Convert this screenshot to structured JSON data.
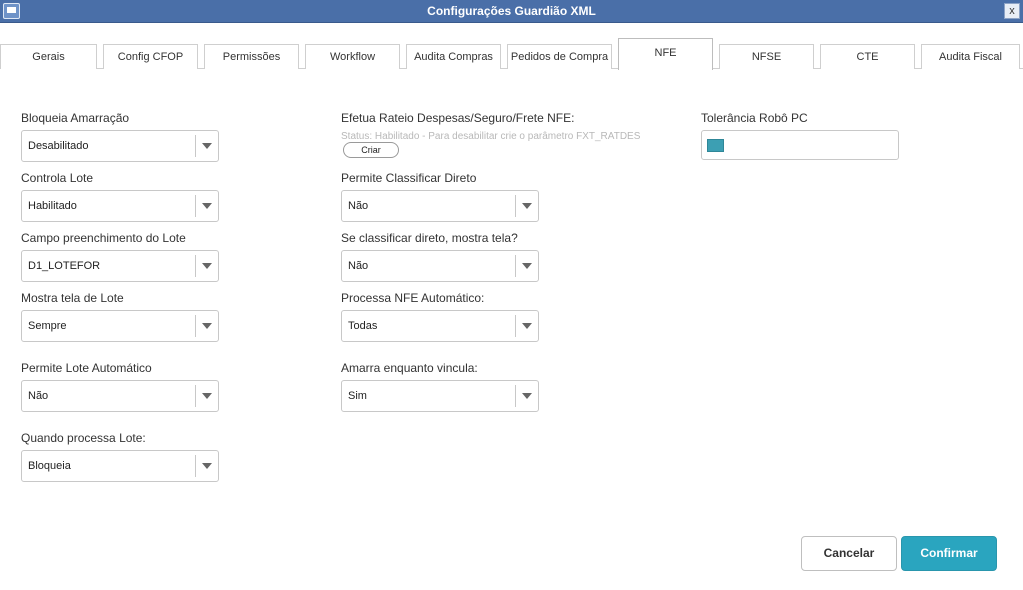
{
  "window": {
    "title": "Configurações Guardião XML",
    "close_label": "x",
    "app_icon": "window-app-icon"
  },
  "tabs": [
    {
      "label": "Gerais"
    },
    {
      "label": "Config CFOP"
    },
    {
      "label": "Permissões"
    },
    {
      "label": "Workflow"
    },
    {
      "label": "Audita Compras"
    },
    {
      "label": "Pedidos de Compra"
    },
    {
      "label": "NFE",
      "active": true
    },
    {
      "label": "NFSE"
    },
    {
      "label": "CTE"
    },
    {
      "label": "Audita Fiscal"
    }
  ],
  "col1": {
    "bloqueia_amarracao": {
      "label": "Bloqueia Amarração",
      "value": "Desabilitado"
    },
    "controla_lote": {
      "label": "Controla Lote",
      "value": "Habilitado"
    },
    "campo_lote": {
      "label": "Campo preenchimento do Lote",
      "value": "D1_LOTEFOR"
    },
    "mostra_tela_lote": {
      "label": "Mostra tela de Lote",
      "value": "Sempre"
    },
    "lote_automatico": {
      "label": "Permite Lote Automático",
      "value": "Não"
    },
    "processa_lote": {
      "label": "Quando processa Lote:",
      "value": "Bloqueia"
    }
  },
  "col2": {
    "rateio": {
      "label": "Efetua Rateio Despesas/Seguro/Frete NFE:",
      "status": "Status: Habilitado - Para desabilitar crie o parâmetro FXT_RATDES",
      "button": "Criar"
    },
    "classificar_direto": {
      "label": "Permite Classificar Direto",
      "value": "Não"
    },
    "mostra_tela": {
      "label": "Se classificar direto, mostra tela?",
      "value": "Não"
    },
    "processa_nfe": {
      "label": "Processa NFE Automático:",
      "value": "Todas"
    },
    "amarra_vincula": {
      "label": "Amarra enquanto vincula:",
      "value": "Sim"
    }
  },
  "col3": {
    "tolerancia": {
      "label": "Tolerância Robô PC",
      "swatch_color": "#3c9fb3"
    }
  },
  "footer": {
    "cancel": "Cancelar",
    "confirm": "Confirmar"
  },
  "colors": {
    "titlebar": "#4a6fa8",
    "accent": "#2aa5bf"
  }
}
